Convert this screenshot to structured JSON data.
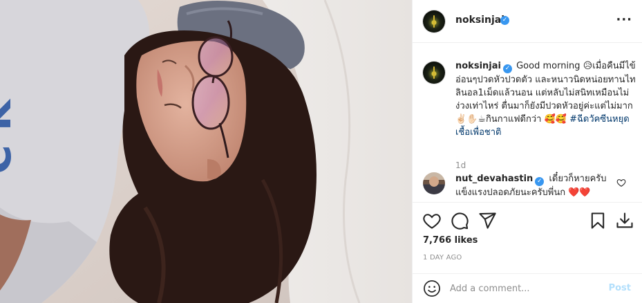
{
  "post": {
    "username": "noksinjai",
    "verified": true,
    "menu_icon": "more-horizontal-icon"
  },
  "caption": {
    "username": "noksinjai",
    "text_1": "Good morning",
    "text_2": "เมื่อคืนมีไข้อ่อนๆปวดหัวปวดตัว และหนาวนิดหน่อยทานไทลินอล1เม็ดแล้วนอน แต่หลับไม่สนิทเหมือนไม่ง่วงเท่าไหร่ ตื่นมาก็ยังมีปวดหัวอยู่ค่ะแต่ไม่มาก",
    "text_3": "กินกาแฟดีกว่า",
    "hashtag": "#ฉีดวัคซีนหยุดเชื้อเพื่อชาติ",
    "time": "1d"
  },
  "comments": [
    {
      "username": "nut_devahastin",
      "verified": true,
      "text": "เดี๋ยวก็หายครับ แข็งแรงปลอดภัยนะครับพี่นก"
    }
  ],
  "actions": {
    "icons": [
      "heart-icon",
      "comment-icon",
      "share-icon",
      "save-icon",
      "download-icon"
    ]
  },
  "likes": "7,766 likes",
  "posted_ago": "1 DAY AGO",
  "comment_box": {
    "placeholder": "Add a comment...",
    "post_label": "Post"
  },
  "colors": {
    "verified": "#3897f0",
    "hashtag": "#00376b",
    "post_disabled": "#b2dffc",
    "heart_red": "#ed4956"
  }
}
